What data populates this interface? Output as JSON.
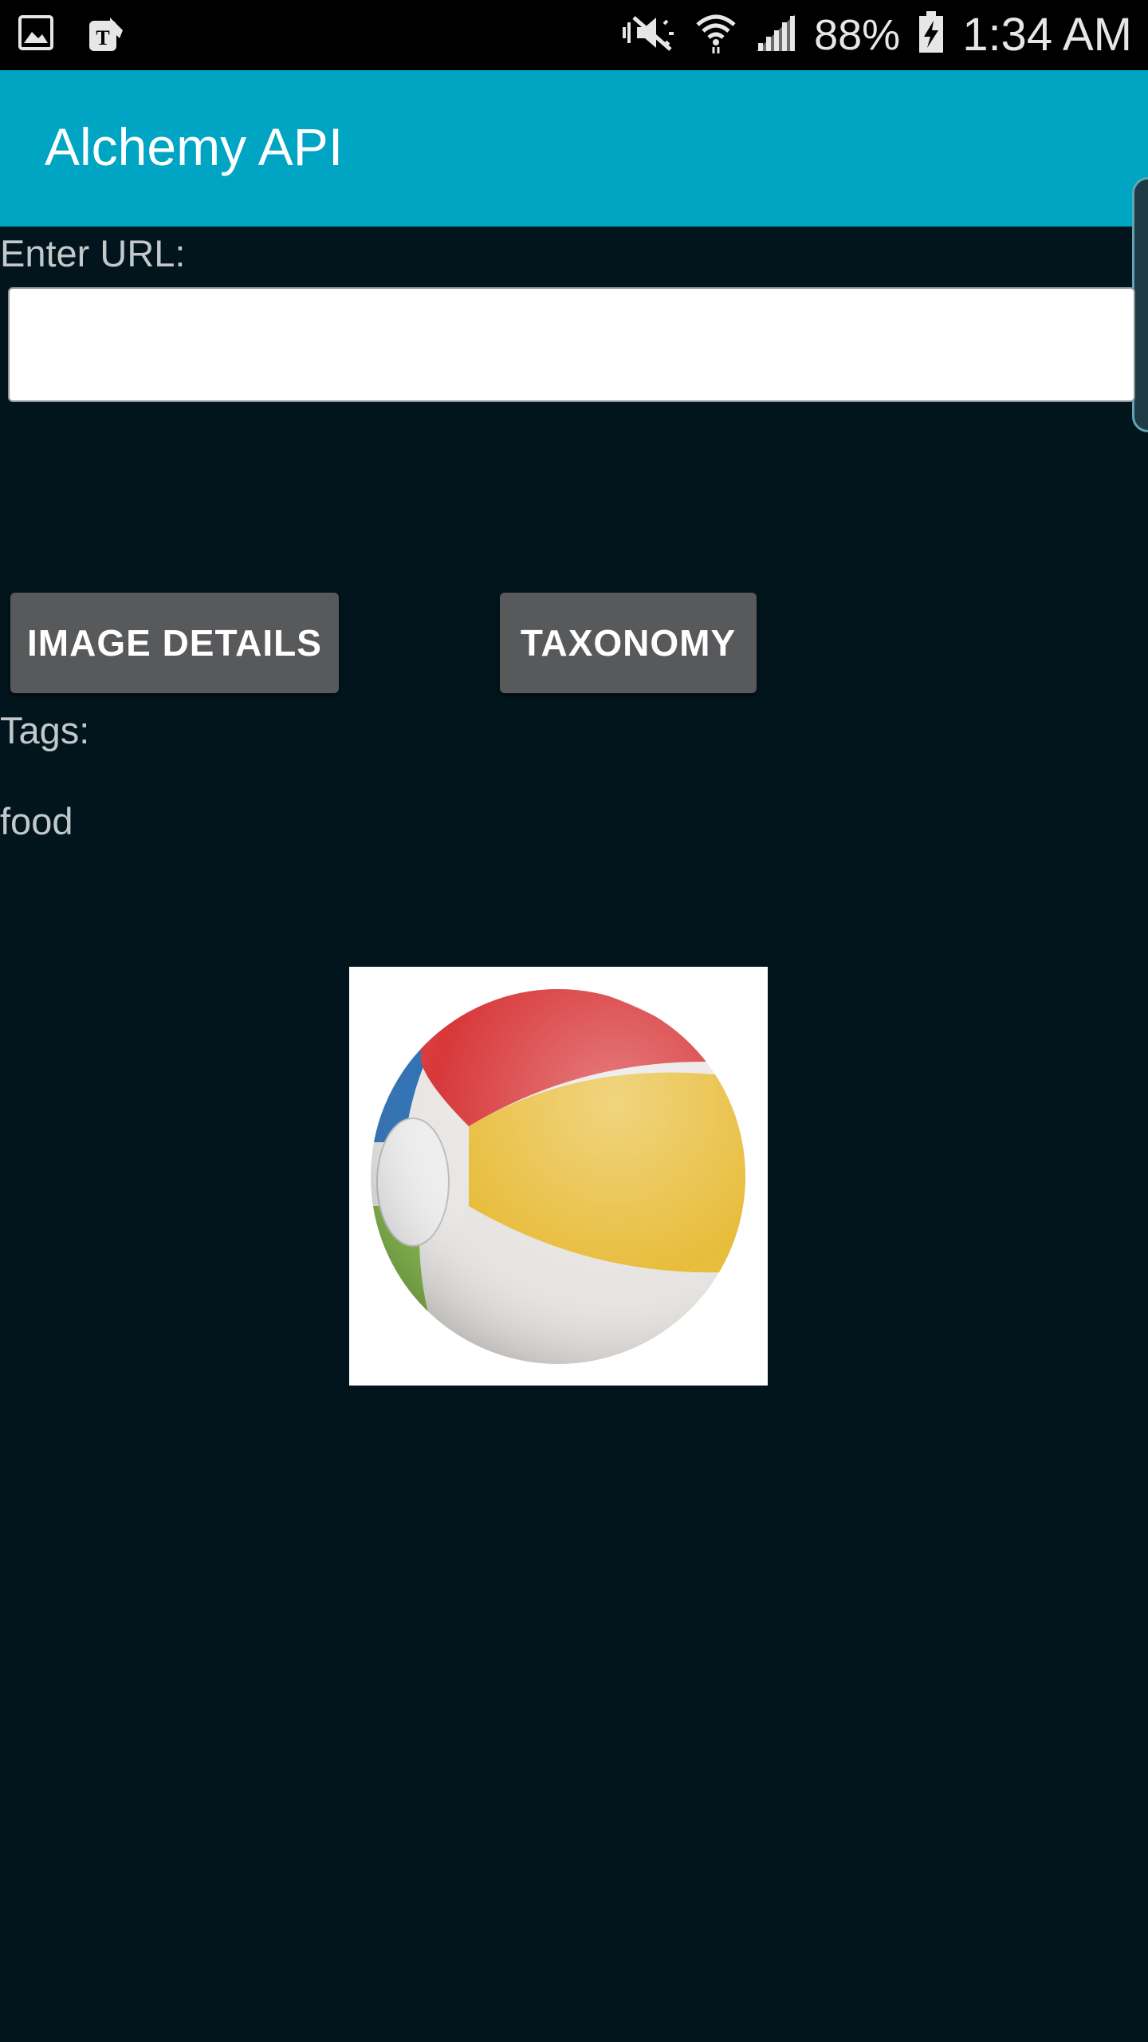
{
  "status_bar": {
    "left_icons": [
      "gallery-icon",
      "tmobile-icon"
    ],
    "right_icons": [
      "mute-icon",
      "wifi-icon",
      "signal-icon"
    ],
    "battery": "88%",
    "time": "1:34 AM"
  },
  "app_bar": {
    "title": "Alchemy API"
  },
  "form": {
    "url_label": "Enter URL:",
    "url_value": "",
    "url_placeholder": ""
  },
  "buttons": {
    "image_details": "IMAGE DETAILS",
    "taxonomy": "TAXONOMY"
  },
  "results": {
    "tags_label": "Tags:",
    "tag_value": "food"
  },
  "image": {
    "subject": "beach-ball-image"
  },
  "colors": {
    "app_bar": "#00a5c4",
    "background": "#02151c",
    "button": "#58595b"
  }
}
